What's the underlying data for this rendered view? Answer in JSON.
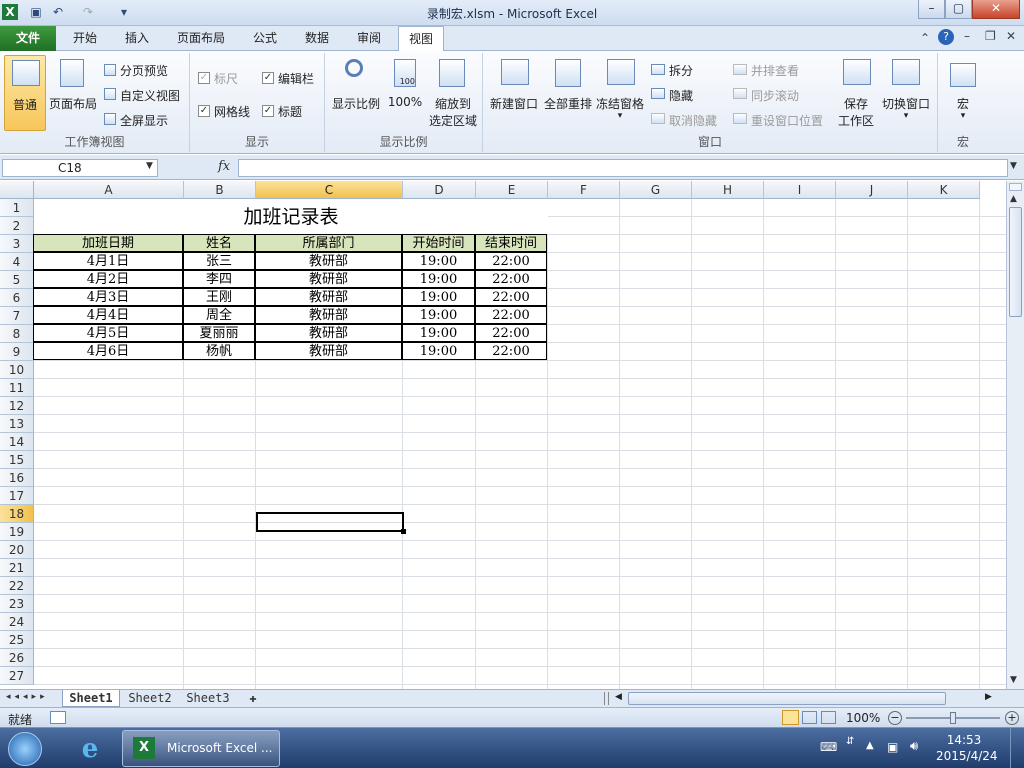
{
  "title": "录制宏.xlsm - Microsoft Excel",
  "quick_access": {
    "icons": [
      "excel-logo-icon",
      "save-icon",
      "undo-icon",
      "redo-icon",
      "customize-icon"
    ]
  },
  "window_controls": {
    "minimize": "–",
    "maximize": "▢",
    "close": "✕"
  },
  "tabs": [
    "文件",
    "开始",
    "插入",
    "页面布局",
    "公式",
    "数据",
    "审阅",
    "视图"
  ],
  "active_tab": "视图",
  "ribbon": {
    "workbook_views": {
      "label": "工作簿视图",
      "normal": "普通",
      "page_layout": "页面布局",
      "page_break": "分页预览",
      "custom_view": "自定义视图",
      "full_screen": "全屏显示"
    },
    "show": {
      "label": "显示",
      "ruler": "标尺",
      "formula_bar": "编辑栏",
      "gridlines": "网格线",
      "headings": "标题"
    },
    "zoom": {
      "label": "显示比例",
      "zoom": "显示比例",
      "zoom100": "100%",
      "zoom_to_sel_1": "缩放到",
      "zoom_to_sel_2": "选定区域"
    },
    "window": {
      "label": "窗口",
      "new_window": "新建窗口",
      "arrange_all": "全部重排",
      "freeze": "冻结窗格",
      "split": "拆分",
      "hide": "隐藏",
      "unhide": "取消隐藏",
      "side_by_side": "并排查看",
      "sync_scroll": "同步滚动",
      "reset_pos": "重设窗口位置",
      "save_ws_1": "保存",
      "save_ws_2": "工作区",
      "switch": "切换窗口"
    },
    "macros": {
      "label": "宏",
      "macros": "宏"
    }
  },
  "formula_bar": {
    "name_box": "C18",
    "fx": "fx",
    "value": ""
  },
  "columns": [
    "A",
    "B",
    "C",
    "D",
    "E",
    "F",
    "G",
    "H",
    "I",
    "J",
    "K"
  ],
  "rows": [
    "1",
    "2",
    "3",
    "4",
    "5",
    "6",
    "7",
    "8",
    "9",
    "10",
    "11",
    "12",
    "13",
    "14",
    "15",
    "16",
    "17",
    "18",
    "19",
    "20",
    "21",
    "22",
    "23",
    "24",
    "25",
    "26",
    "27"
  ],
  "selected_cell": "C18",
  "sheet": {
    "title": "加班记录表",
    "headers": [
      "加班日期",
      "姓名",
      "所属部门",
      "开始时间",
      "结束时间"
    ],
    "records": [
      [
        "4月1日",
        "张三",
        "教研部",
        "19:00",
        "22:00"
      ],
      [
        "4月2日",
        "李四",
        "教研部",
        "19:00",
        "22:00"
      ],
      [
        "4月3日",
        "王刚",
        "教研部",
        "19:00",
        "22:00"
      ],
      [
        "4月4日",
        "周全",
        "教研部",
        "19:00",
        "22:00"
      ],
      [
        "4月5日",
        "夏丽丽",
        "教研部",
        "19:00",
        "22:00"
      ],
      [
        "4月6日",
        "杨帆",
        "教研部",
        "19:00",
        "22:00"
      ]
    ],
    "header_fill": "#d8e4bc"
  },
  "sheet_tabs": [
    "Sheet1",
    "Sheet2",
    "Sheet3"
  ],
  "active_sheet": "Sheet1",
  "status": {
    "ready": "就绪",
    "zoom": "100%"
  },
  "taskbar": {
    "app": "Microsoft Excel ...",
    "time": "14:53",
    "date": "2015/4/24"
  }
}
